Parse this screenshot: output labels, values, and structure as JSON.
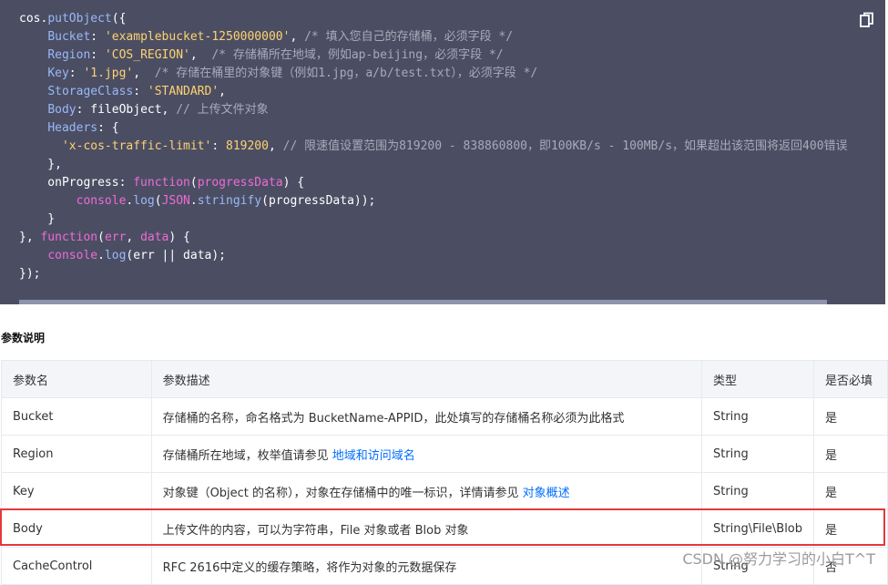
{
  "code": {
    "lines": [
      [
        {
          "t": "cos.",
          "c": "p"
        },
        {
          "t": "putObject",
          "c": "k"
        },
        {
          "t": "({",
          "c": "p"
        }
      ],
      [
        {
          "t": "    ",
          "c": "p"
        },
        {
          "t": "Bucket",
          "c": "k"
        },
        {
          "t": ": ",
          "c": "p"
        },
        {
          "t": "'examplebucket-1250000000'",
          "c": "s"
        },
        {
          "t": ", ",
          "c": "p"
        },
        {
          "t": "/* 填入您自己的存储桶，必须字段 */",
          "c": "c"
        }
      ],
      [
        {
          "t": "    ",
          "c": "p"
        },
        {
          "t": "Region",
          "c": "k"
        },
        {
          "t": ": ",
          "c": "p"
        },
        {
          "t": "'COS_REGION'",
          "c": "s"
        },
        {
          "t": ",  ",
          "c": "p"
        },
        {
          "t": "/* 存储桶所在地域，例如ap-beijing，必须字段 */",
          "c": "c"
        }
      ],
      [
        {
          "t": "    ",
          "c": "p"
        },
        {
          "t": "Key",
          "c": "k"
        },
        {
          "t": ": ",
          "c": "p"
        },
        {
          "t": "'1.jpg'",
          "c": "s"
        },
        {
          "t": ",  ",
          "c": "p"
        },
        {
          "t": "/* 存储在桶里的对象键（例如1.jpg，a/b/test.txt），必须字段 */",
          "c": "c"
        }
      ],
      [
        {
          "t": "    ",
          "c": "p"
        },
        {
          "t": "StorageClass",
          "c": "k"
        },
        {
          "t": ": ",
          "c": "p"
        },
        {
          "t": "'STANDARD'",
          "c": "s"
        },
        {
          "t": ",",
          "c": "p"
        }
      ],
      [
        {
          "t": "    ",
          "c": "p"
        },
        {
          "t": "Body",
          "c": "k"
        },
        {
          "t": ": fileObject, ",
          "c": "p"
        },
        {
          "t": "// 上传文件对象",
          "c": "c"
        }
      ],
      [
        {
          "t": "    ",
          "c": "p"
        },
        {
          "t": "Headers",
          "c": "k"
        },
        {
          "t": ": {",
          "c": "p"
        }
      ],
      [
        {
          "t": "      ",
          "c": "p"
        },
        {
          "t": "'x-cos-traffic-limit'",
          "c": "s"
        },
        {
          "t": ": ",
          "c": "p"
        },
        {
          "t": "819200",
          "c": "s"
        },
        {
          "t": ", ",
          "c": "p"
        },
        {
          "t": "// 限速值设置范围为819200 - 838860800，即100KB/s - 100MB/s，如果超出该范围将返回400错误",
          "c": "c"
        }
      ],
      [
        {
          "t": "    },",
          "c": "p"
        }
      ],
      [
        {
          "t": "    onProgress: ",
          "c": "p"
        },
        {
          "t": "function",
          "c": "f"
        },
        {
          "t": "(",
          "c": "p"
        },
        {
          "t": "progressData",
          "c": "f"
        },
        {
          "t": ") {",
          "c": "p"
        }
      ],
      [
        {
          "t": "        ",
          "c": "p"
        },
        {
          "t": "console",
          "c": "f"
        },
        {
          "t": ".",
          "c": "p"
        },
        {
          "t": "log",
          "c": "k"
        },
        {
          "t": "(",
          "c": "p"
        },
        {
          "t": "JSON",
          "c": "f"
        },
        {
          "t": ".",
          "c": "p"
        },
        {
          "t": "stringify",
          "c": "k"
        },
        {
          "t": "(progressData));",
          "c": "p"
        }
      ],
      [
        {
          "t": "    }",
          "c": "p"
        }
      ],
      [
        {
          "t": "}, ",
          "c": "p"
        },
        {
          "t": "function",
          "c": "f"
        },
        {
          "t": "(",
          "c": "p"
        },
        {
          "t": "err",
          "c": "f"
        },
        {
          "t": ", ",
          "c": "p"
        },
        {
          "t": "data",
          "c": "f"
        },
        {
          "t": ") {",
          "c": "p"
        }
      ],
      [
        {
          "t": "    ",
          "c": "p"
        },
        {
          "t": "console",
          "c": "f"
        },
        {
          "t": ".",
          "c": "p"
        },
        {
          "t": "log",
          "c": "k"
        },
        {
          "t": "(err || data);",
          "c": "p"
        }
      ],
      [
        {
          "t": "});",
          "c": "p"
        }
      ]
    ],
    "copy_icon": "copy-icon",
    "colors": {
      "background": "#4b4e63",
      "keyword": "#9ab8f7",
      "string": "#ffd270",
      "comment": "#a7aab8",
      "function": "#ee6bd4",
      "plain": "#ffffff"
    }
  },
  "section_title": "参数说明",
  "table": {
    "headers": [
      "参数名",
      "参数描述",
      "类型",
      "是否必填"
    ],
    "rows": [
      {
        "name": "Bucket",
        "desc": "存储桶的名称，命名格式为 BucketName-APPID，此处填写的存储桶名称必须为此格式",
        "link": "",
        "type": "String",
        "required": "是"
      },
      {
        "name": "Region",
        "desc": "存储桶所在地域，枚举值请参见 ",
        "link": "地域和访问域名",
        "type": "String",
        "required": "是"
      },
      {
        "name": "Key",
        "desc": "对象键（Object 的名称），对象在存储桶中的唯一标识，详情请参见 ",
        "link": "对象概述",
        "type": "String",
        "required": "是"
      },
      {
        "name": "Body",
        "desc": "上传文件的内容，可以为字符串，File 对象或者 Blob 对象",
        "link": "",
        "type": "String\\File\\Blob",
        "required": "是"
      },
      {
        "name": "CacheControl",
        "desc": "RFC 2616中定义的缓存策略，将作为对象的元数据保存",
        "link": "",
        "type": "String",
        "required": "否"
      }
    ],
    "link_color": "#006eff",
    "highlight_color": "#e4393c"
  },
  "watermark": "CSDN @努力学习的小白T^T"
}
